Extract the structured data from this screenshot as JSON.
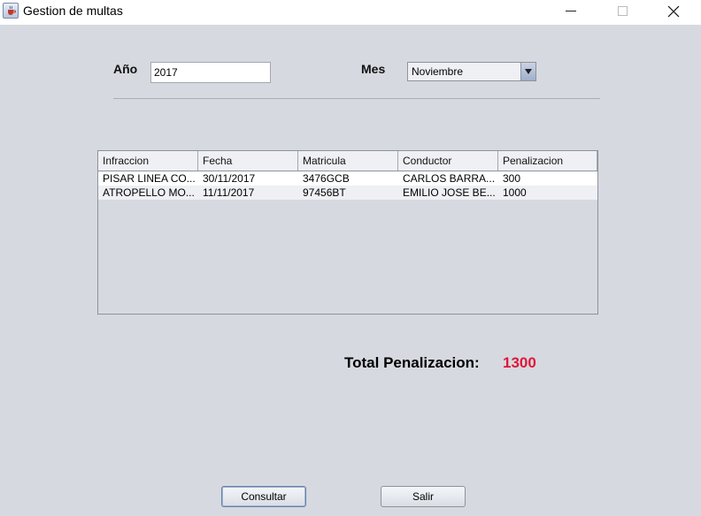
{
  "window": {
    "title": "Gestion de multas",
    "icon": "java-cup-icon",
    "controls": [
      "minimize",
      "maximize",
      "close"
    ]
  },
  "filters": {
    "year_label": "Año",
    "year_value": "2017",
    "month_label": "Mes",
    "month_value": "Noviembre"
  },
  "table": {
    "columns": [
      "Infraccion",
      "Fecha",
      "Matricula",
      "Conductor",
      "Penalizacion"
    ],
    "rows": [
      [
        "PISAR LINEA CO...",
        "30/11/2017",
        "3476GCB",
        "CARLOS BARRA...",
        "300"
      ],
      [
        "ATROPELLO MO...",
        "11/11/2017",
        "97456BT",
        "EMILIO JOSE BE...",
        "1000"
      ]
    ]
  },
  "total": {
    "label": "Total Penalizacion:",
    "value": "1300",
    "value_color": "#e0173a"
  },
  "buttons": {
    "consultar": "Consultar",
    "salir": "Salir"
  }
}
